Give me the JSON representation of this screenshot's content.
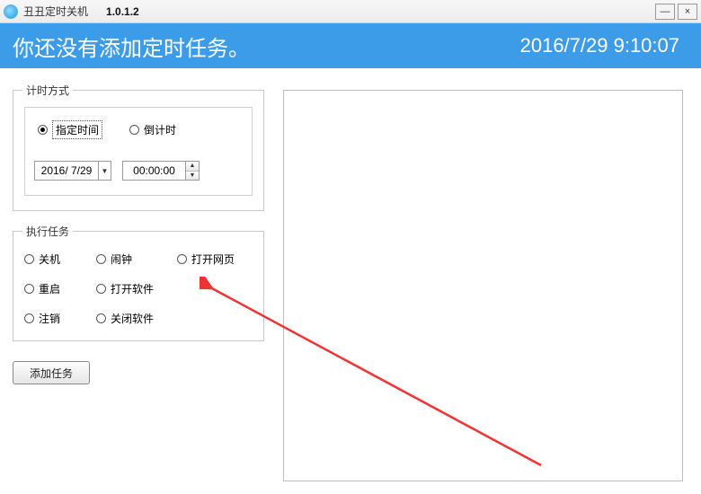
{
  "titlebar": {
    "app_name": "丑丑定时关机",
    "version": "1.0.1.2",
    "minimize": "—",
    "close": "×"
  },
  "banner": {
    "message": "你还没有添加定时任务。",
    "datetime": "2016/7/29 9:10:07"
  },
  "timing": {
    "legend": "计时方式",
    "opt_specified": "指定时间",
    "opt_countdown": "倒计时",
    "selected": "specified",
    "date_value": "2016/ 7/29",
    "time_value": "00:00:00"
  },
  "tasks": {
    "legend": "执行任务",
    "options": [
      "关机",
      "闹钟",
      "打开网页",
      "重启",
      "打开软件",
      "注销",
      "关闭软件"
    ]
  },
  "buttons": {
    "add_task": "添加任务"
  }
}
